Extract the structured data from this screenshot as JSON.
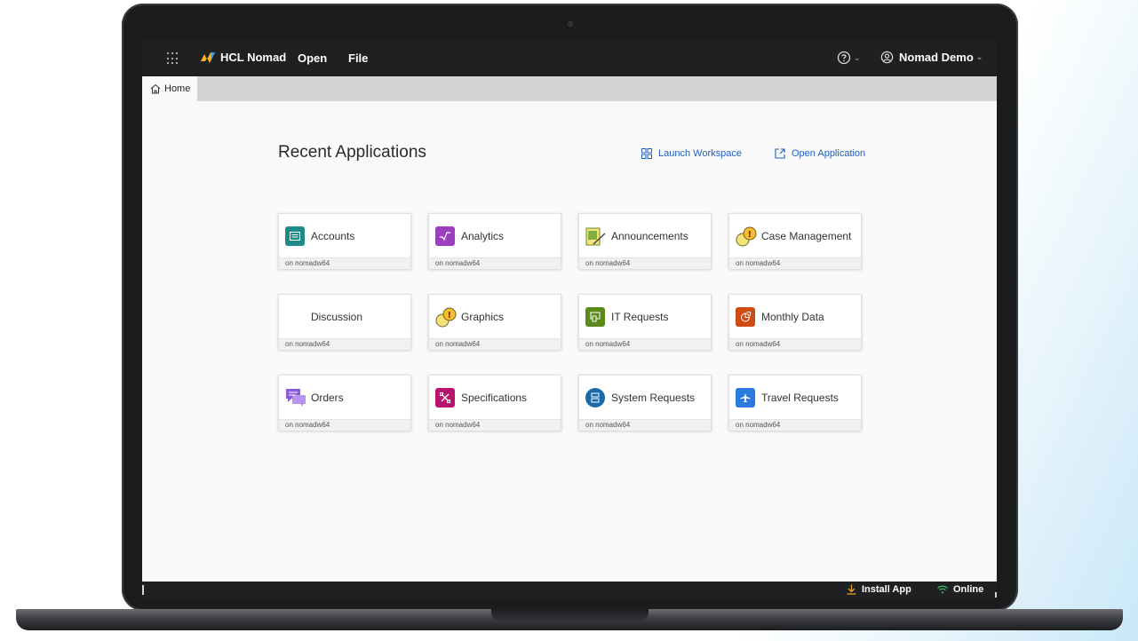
{
  "topbar": {
    "brand": "HCL Nomad",
    "menu_open": "Open",
    "menu_file": "File",
    "help_chevron": "⌄",
    "user_name": "Nomad Demo",
    "user_chevron": "⌄"
  },
  "tabs": {
    "home_label": "Home"
  },
  "main": {
    "title": "Recent Applications",
    "launch_workspace": "Launch Workspace",
    "open_application": "Open Application"
  },
  "apps": [
    {
      "name": "Accounts",
      "server": "on nomadw64",
      "icon": "accounts-icon",
      "color": "#1e8a8a"
    },
    {
      "name": "Analytics",
      "server": "on nomadw64",
      "icon": "analytics-icon",
      "color": "#9b3fc0"
    },
    {
      "name": "Announcements",
      "server": "on nomadw64",
      "icon": "announcements-icon",
      "color": "#6a8a2a"
    },
    {
      "name": "Case Management",
      "server": "on nomadw64",
      "icon": "case-management-icon",
      "color": "#e0b020"
    },
    {
      "name": "Discussion",
      "server": "on nomadw64",
      "icon": "discussion-icon",
      "color": "#ffffff"
    },
    {
      "name": "Graphics",
      "server": "on nomadw64",
      "icon": "graphics-icon",
      "color": "#e0b020"
    },
    {
      "name": "IT Requests",
      "server": "on nomadw64",
      "icon": "it-requests-icon",
      "color": "#5a8a1a"
    },
    {
      "name": "Monthly Data",
      "server": "on nomadw64",
      "icon": "monthly-data-icon",
      "color": "#d04a14"
    },
    {
      "name": "Orders",
      "server": "on nomadw64",
      "icon": "orders-icon",
      "color": "#8a5ad8"
    },
    {
      "name": "Specifications",
      "server": "on nomadw64",
      "icon": "specifications-icon",
      "color": "#b8146e"
    },
    {
      "name": "System Requests",
      "server": "on nomadw64",
      "icon": "system-requests-icon",
      "color": "#1a6aa8"
    },
    {
      "name": "Travel Requests",
      "server": "on nomadw64",
      "icon": "travel-requests-icon",
      "color": "#2a7ae0"
    }
  ],
  "statusbar": {
    "install_app": "Install App",
    "online": "Online"
  },
  "colors": {
    "topbar_bg": "#1e2022",
    "link": "#1f5fbf",
    "online": "#3ec46d",
    "install": "#f0a020"
  }
}
